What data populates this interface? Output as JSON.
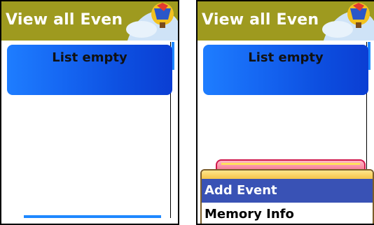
{
  "left": {
    "title": "View all Event",
    "list_text": "List empty"
  },
  "right": {
    "title": "View all Event",
    "list_text": "List empty",
    "menu": {
      "items": [
        {
          "label": "Add Event",
          "selected": true
        },
        {
          "label": "Memory Info",
          "selected": false
        }
      ]
    }
  },
  "colors": {
    "titlebar": "#9e9a1f",
    "list_blue": "#1566f2",
    "menu_selected": "#3952b5"
  }
}
